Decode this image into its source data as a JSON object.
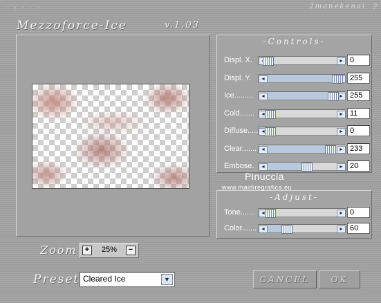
{
  "window": {
    "title": "Mezzoforce-Ice",
    "version": "v.1.03",
    "brand": "2manekenai",
    "help": "?",
    "dots": ": : : : :"
  },
  "controls": {
    "title": "-Controls-",
    "sliders": [
      {
        "label": "Displ. X.",
        "value": "0",
        "level": 0.1
      },
      {
        "label": "Displ. Y.",
        "value": "255",
        "level": 0.9
      },
      {
        "label": "Ice.........",
        "value": "255",
        "level": 0.85
      },
      {
        "label": "Cold.......",
        "value": "11",
        "level": 0.13
      },
      {
        "label": "Diffuse.....",
        "value": "0",
        "level": 0.13
      },
      {
        "label": "Clear.......",
        "value": "233",
        "level": 0.82
      },
      {
        "label": "Embose.",
        "value": "20",
        "level": 0.55
      }
    ]
  },
  "adjust": {
    "title": "-Adjust-",
    "sliders": [
      {
        "label": "Tone.......",
        "value": "0",
        "level": 0.13
      },
      {
        "label": "Color.......",
        "value": "60",
        "level": 0.32
      }
    ]
  },
  "watermark": {
    "name": "Pinuccia",
    "url": "www.maidiregrafica.eu"
  },
  "zoom": {
    "label": "Zoom",
    "value": "25%",
    "plus": "+",
    "minus": "−"
  },
  "preset": {
    "label": "Preset",
    "selected": "Cleared Ice"
  },
  "buttons": {
    "cancel": "CANCEL",
    "ok": "OK"
  }
}
